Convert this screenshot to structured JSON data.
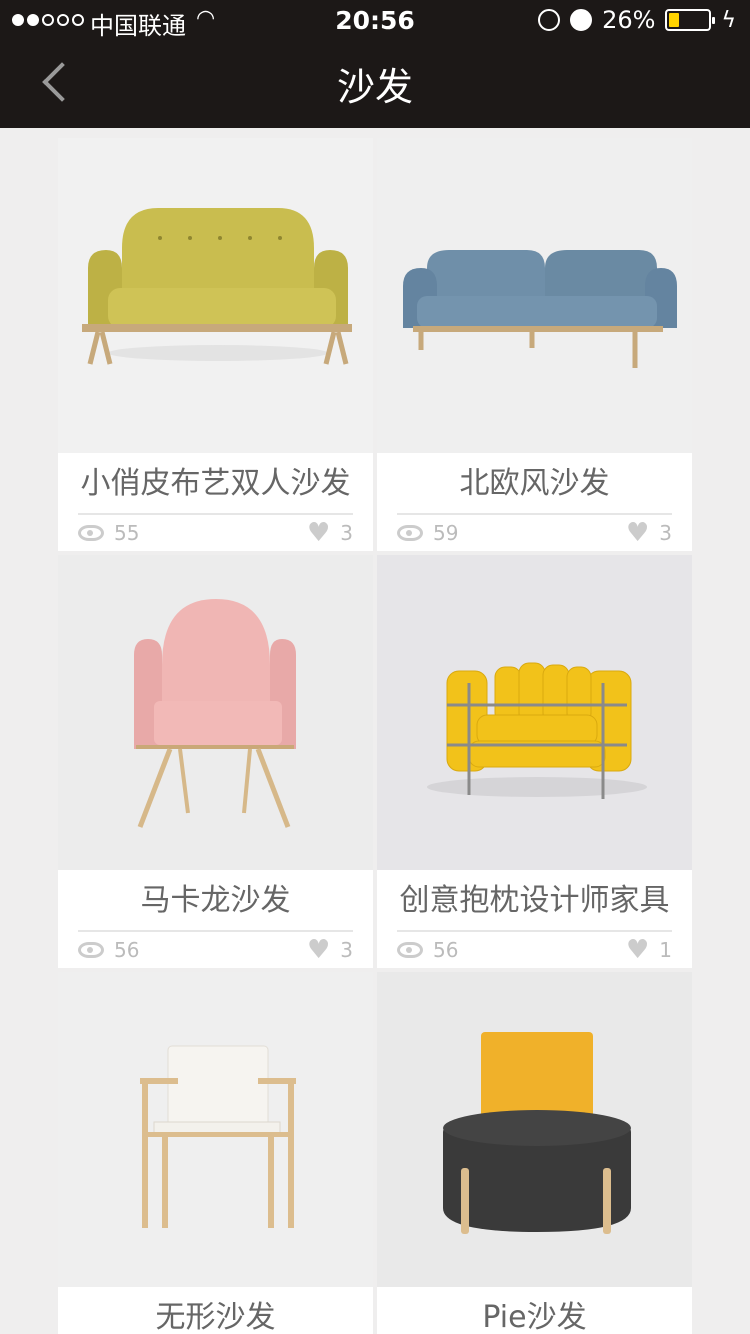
{
  "status_bar": {
    "carrier": "中国联通",
    "time": "20:56",
    "battery": "26%",
    "battery_level": 0.26
  },
  "nav": {
    "title": "沙发"
  },
  "products": [
    {
      "title": "小俏皮布艺双人沙发",
      "views": "55",
      "likes": "3"
    },
    {
      "title": "北欧风沙发",
      "views": "59",
      "likes": "3"
    },
    {
      "title": "马卡龙沙发",
      "views": "56",
      "likes": "3"
    },
    {
      "title": "创意抱枕设计师家具",
      "views": "56",
      "likes": "1"
    },
    {
      "title": "无形沙发"
    },
    {
      "title": "Pie沙发"
    }
  ],
  "colors": {
    "header": "#1c1817",
    "yellow_sofa": "#c9bd4f",
    "blue_sofa": "#6f8fa9",
    "pink_chair": "#efb1b0",
    "yellow_pillows": "#f2c21a",
    "pie_seat": "#3a3a3a",
    "pie_back": "#f0b12a"
  }
}
